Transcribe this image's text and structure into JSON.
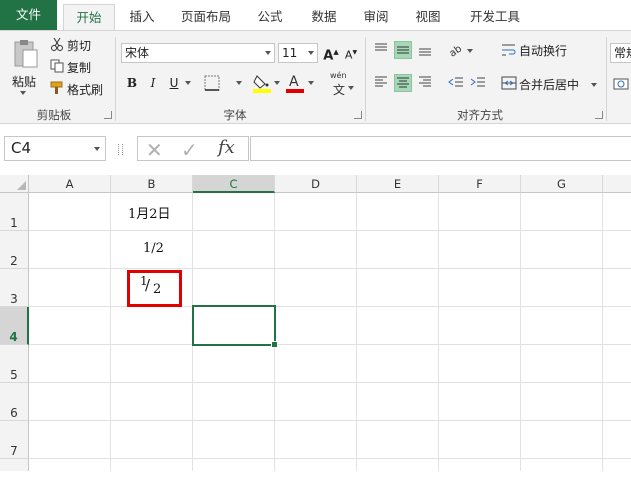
{
  "tabs": [
    "文件",
    "开始",
    "插入",
    "页面布局",
    "公式",
    "数据",
    "审阅",
    "视图",
    "开发工具"
  ],
  "clipboard": {
    "paste": "粘贴",
    "cut": "剪切",
    "copy": "复制",
    "format_painter": "格式刷",
    "group": "剪贴板"
  },
  "font": {
    "name": "宋体",
    "size": "11",
    "bold": "B",
    "italic": "I",
    "underline": "U",
    "grow": "A",
    "shrink": "A",
    "fill_color": "#ffff00",
    "font_color": "#e00000",
    "phonetic_top": "wén",
    "phonetic_bottom": "文",
    "group": "字体"
  },
  "alignment": {
    "wrap": "自动换行",
    "merge": "合并后居中",
    "group": "对齐方式"
  },
  "number": {
    "format": "常规"
  },
  "formula_bar": {
    "name_box": "C4",
    "fx": "fx",
    "cancel": "✕",
    "enter": "✓",
    "value": ""
  },
  "sheet": {
    "columns": [
      "A",
      "B",
      "C",
      "D",
      "E",
      "F",
      "G"
    ],
    "rows": [
      "1",
      "2",
      "3",
      "4",
      "5",
      "6",
      "7"
    ],
    "selected_cell": "C4",
    "cells": {
      "B1": "1月2日",
      "B2": "1/2",
      "B3_num": "1",
      "B3_den": "2"
    }
  },
  "colors": {
    "accent": "#217346",
    "highlight": "#e00000"
  }
}
